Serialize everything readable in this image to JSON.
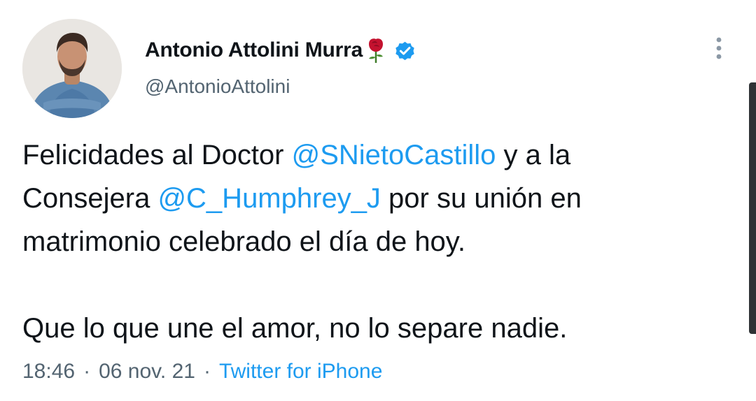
{
  "author": {
    "display_name": "Antonio Attolini Murra",
    "handle": "@AntonioAttolini",
    "name_emoji": "rose-icon",
    "verified": true
  },
  "tweet": {
    "line1_pre": "Felicidades al Doctor ",
    "line1_mention": "@SNietoCastillo",
    "line1_post": " y a la",
    "line2_pre": "Consejera ",
    "line2_mention": "@C_Humphrey_J",
    "line2_post": " por su unión en",
    "line3": "matrimonio celebrado el día de hoy.",
    "line4": "Que lo que une el amor, no lo separe  nadie."
  },
  "meta": {
    "time": "18:46",
    "separator": "·",
    "date": "06 nov. 21",
    "source": "Twitter for iPhone"
  },
  "colors": {
    "link": "#1d9bf0",
    "secondary_text": "#536471",
    "verified_badge": "#1d9bf0"
  }
}
